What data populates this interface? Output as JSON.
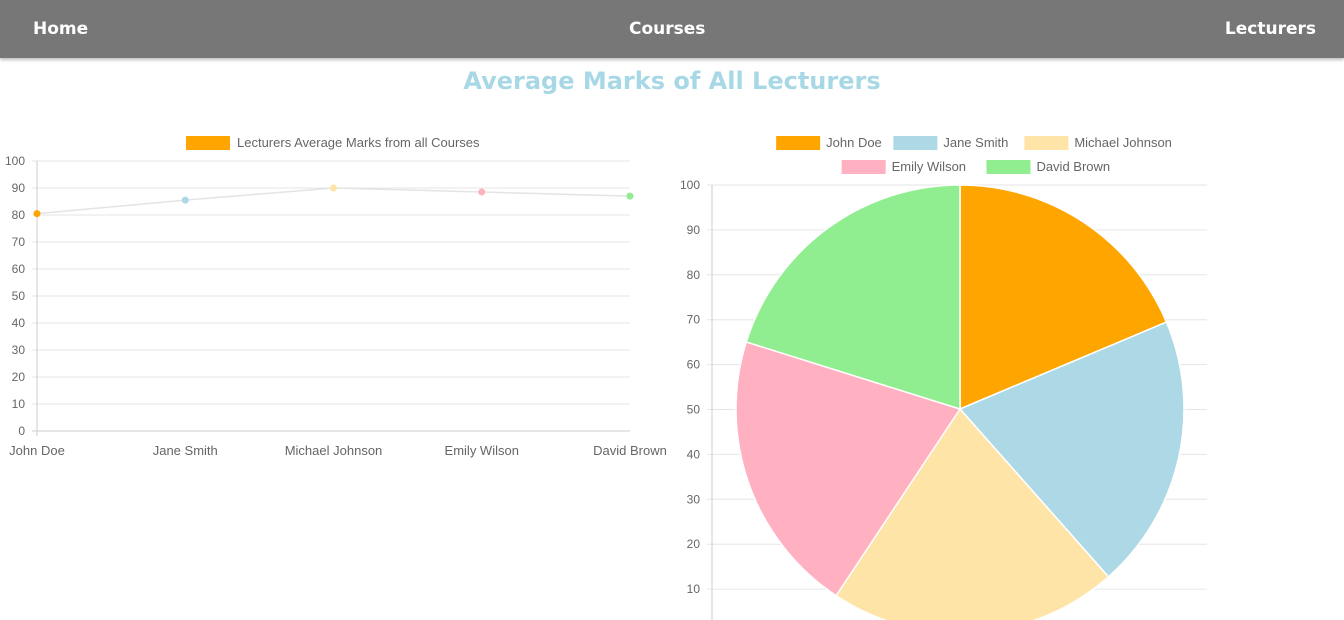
{
  "nav": {
    "home": "Home",
    "courses": "Courses",
    "lecturers": "Lecturers"
  },
  "page": {
    "title": "Average Marks of All Lecturers"
  },
  "chart_data": [
    {
      "type": "line",
      "title": "",
      "xlabel": "",
      "ylabel": "",
      "categories": [
        "John Doe",
        "Jane Smith",
        "Michael Johnson",
        "Emily Wilson",
        "David Brown"
      ],
      "series": [
        {
          "name": "Lecturers Average Marks from all Courses",
          "values": [
            80.5,
            85.5,
            90,
            88.5,
            87
          ],
          "point_colors": [
            "#FFA500",
            "#ADD8E6",
            "#FFE4A8",
            "#FFB0C1",
            "#90EE90"
          ],
          "line_color": "#e4e4e4",
          "legend_color": "#FFA500"
        }
      ],
      "ylim": [
        0,
        100
      ],
      "yticks": [
        0,
        10,
        20,
        30,
        40,
        50,
        60,
        70,
        80,
        90,
        100
      ],
      "grid": true,
      "legend": "top"
    },
    {
      "type": "pie",
      "title": "",
      "labels": [
        "John Doe",
        "Jane Smith",
        "Michael Johnson",
        "Emily Wilson",
        "David Brown"
      ],
      "values": [
        80.5,
        85.5,
        90,
        88.5,
        87
      ],
      "colors": [
        "#FFA500",
        "#ADD8E6",
        "#FFE4A8",
        "#FFB0C1",
        "#90EE90"
      ],
      "ylim": [
        0,
        100
      ],
      "yticks": [
        10,
        20,
        30,
        40,
        50,
        60,
        70,
        80,
        90,
        100
      ],
      "grid": true,
      "legend": "top"
    }
  ]
}
